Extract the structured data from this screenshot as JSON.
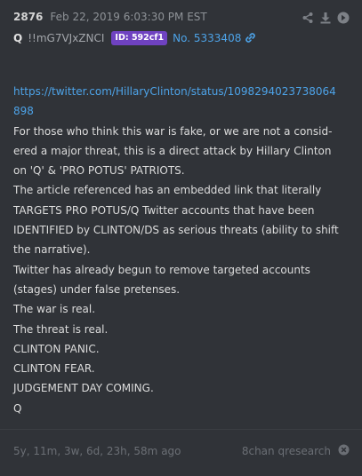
{
  "post": {
    "number": "2876",
    "timestamp": "Feb 22, 2019 6:03:30 PM EST",
    "author": "Q",
    "tripcode": "!!mG7VJxZNCI",
    "id_badge": "ID: 592cf1",
    "post_no": "No. 5333408"
  },
  "icons": {
    "share": "share-icon",
    "download": "download-icon",
    "go": "arrow-circle-icon",
    "link": "link-icon",
    "close": "close-circle-icon"
  },
  "body": {
    "link_line1": "https://twitter.com/HillaryClinton/status/1098294023738064",
    "link_line2": "898",
    "lines": [
      "For those who think this war is fake, or we are not a consid-",
      "ered a major threat, this is a direct attack by Hillary Clinton",
      "on 'Q' & 'PRO POTUS' PATRIOTS.",
      "The article referenced has an embedded link that literally",
      "TARGETS PRO POTUS/Q Twitter accounts that have been",
      "IDENTIFIED by CLINTON/DS as serious threats (ability to shift",
      "the narrative).",
      "Twitter has already begun to remove targeted accounts",
      "(stages) under false pretenses.",
      "The war is real.",
      "The threat is real.",
      "CLINTON PANIC.",
      "CLINTON FEAR.",
      "JUDGEMENT DAY COMING.",
      "Q"
    ]
  },
  "footer": {
    "age": "5y, 11m, 3w, 6d, 23h, 58m ago",
    "source": "8chan qresearch"
  },
  "colors": {
    "background": "#303338",
    "link": "#4da3e8",
    "id_badge": "#6f42c1",
    "text": "#dcdcdc"
  }
}
